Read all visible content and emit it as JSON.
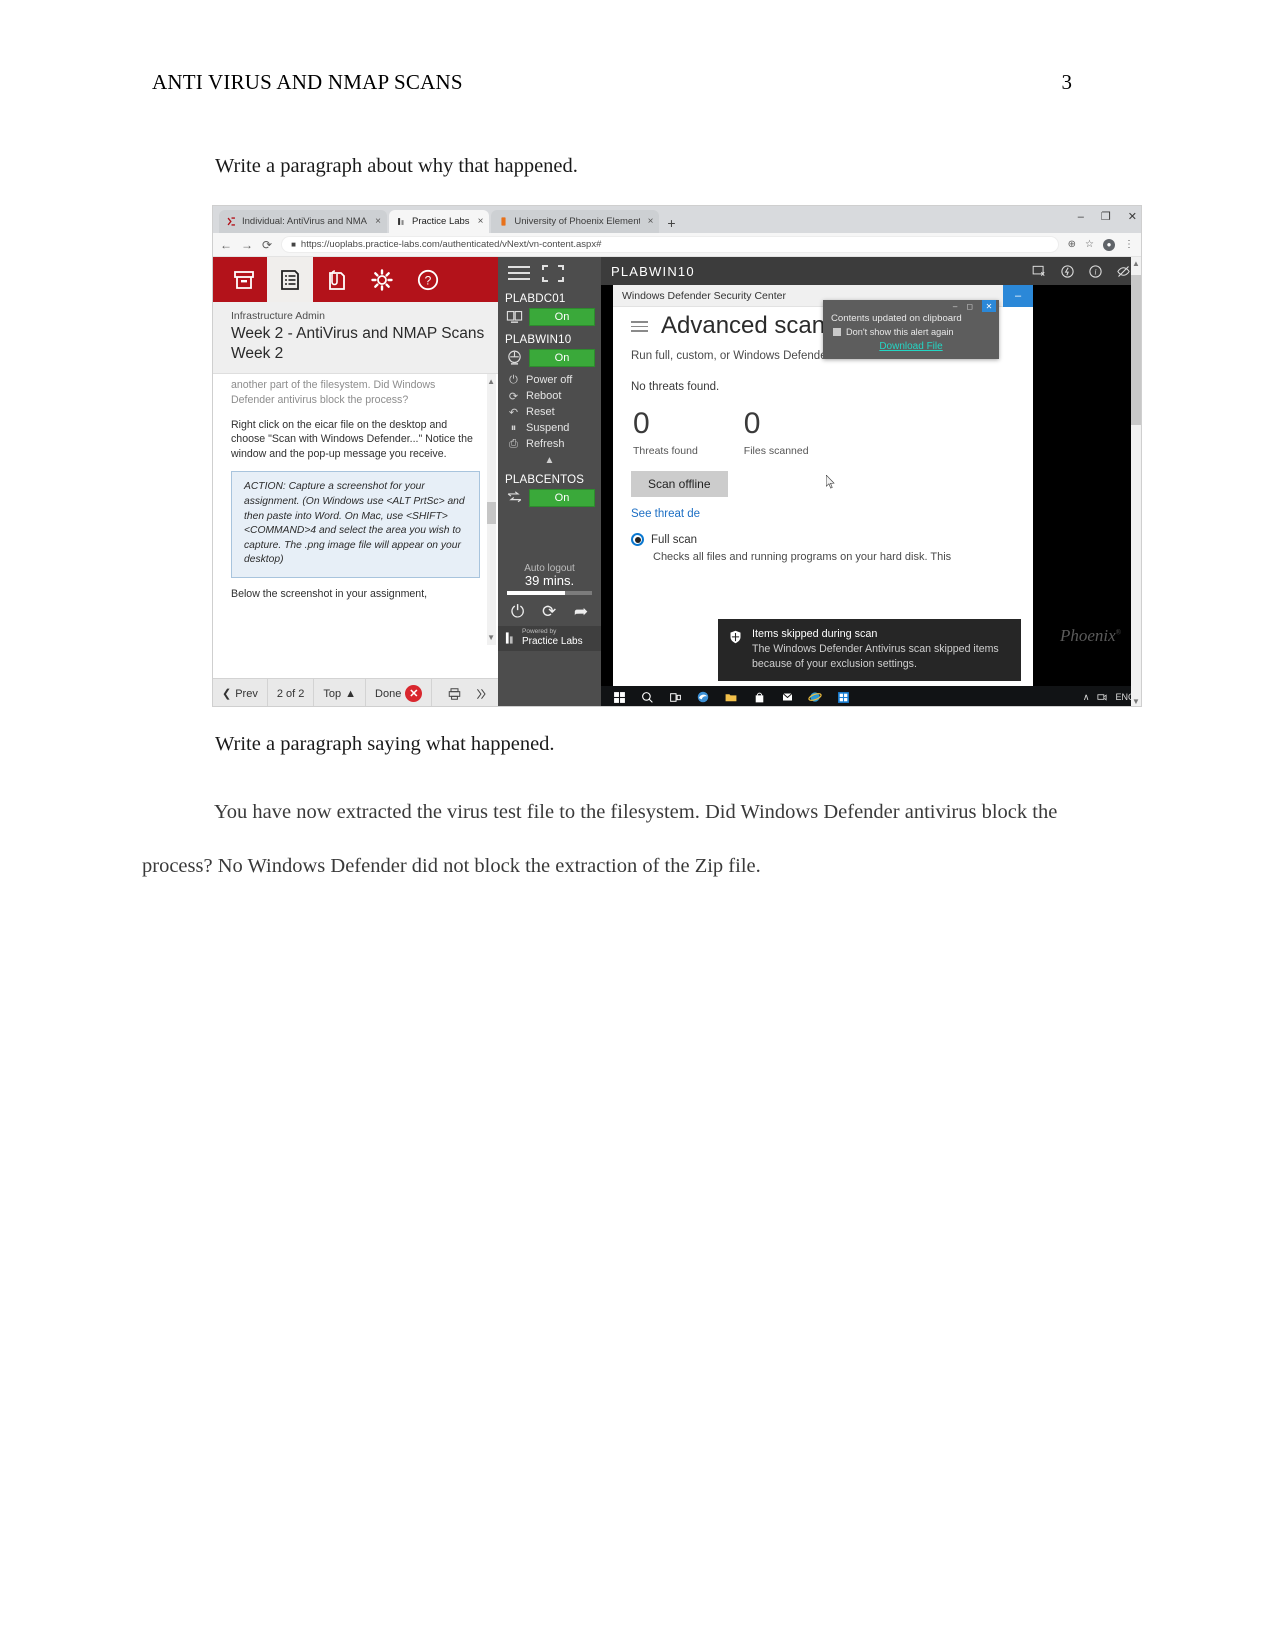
{
  "document": {
    "running_head": "ANTI VIRUS AND NMAP SCANS",
    "page_number": "3",
    "para_why": "Write a paragraph about why that happened.",
    "para_what": "Write a paragraph saying what happened.",
    "para_body": "You have now extracted the virus test file to the filesystem. Did Windows Defender antivirus block the process? No Windows Defender did not block the extraction of the Zip file."
  },
  "browser": {
    "tabs": [
      {
        "title": "Individual: AntiVirus and NMAP",
        "close": "×",
        "active": false
      },
      {
        "title": "Practice Labs",
        "close": "×",
        "active": true
      },
      {
        "title": "University of Phoenix Elementor",
        "close": "×",
        "active": false
      }
    ],
    "new_tab": "+",
    "window_controls": {
      "minimize": "–",
      "maximize": "❐",
      "close": "✕"
    },
    "nav": {
      "back": "←",
      "forward": "→",
      "reload": "⟳"
    },
    "url": "https://uoplabs.practice-labs.com/authenticated/vNext/vn-content.aspx#",
    "lock": "🔒",
    "zoom_icon": "⊕",
    "star_icon": "☆",
    "profile_initial": "●",
    "menu_icon": "⋮"
  },
  "lab": {
    "toolbar_icons": [
      "archive-icon",
      "content-icon",
      "attachment-icon",
      "settings-icon",
      "help-icon"
    ],
    "role": "Infrastructure Admin",
    "title": "Week 2 - AntiVirus and NMAP Scans",
    "week": "Week 2",
    "instructions": {
      "clipped": "another part of the filesystem. Did Windows Defender antivirus block the process?",
      "p2": "Right click on the eicar file on the desktop and choose \"Scan with Windows Defender...\" Notice the window and the pop-up message you receive.",
      "action": "ACTION: Capture a screenshot for your assignment. (On Windows use <ALT PrtSc> and then paste into Word. On Mac, use <SHIFT> <COMMAND>4 and select the area you wish to capture. The .png image file will appear on your desktop)",
      "p4": "Below the screenshot in your assignment,"
    },
    "nav": {
      "prev": "Prev",
      "page_counter": "2 of 2",
      "top": "Top",
      "done": "Done",
      "close": "✕",
      "print_icon": "print-icon",
      "notes_icon": "notes-icon"
    }
  },
  "vm_rail": {
    "menu_icon": "hamburger-icon",
    "expand_icon": "fullscreen-icon",
    "machines": [
      {
        "name": "PLABDC01",
        "state": "On",
        "icon": "server-icon",
        "expanded": false
      },
      {
        "name": "PLABWIN10",
        "state": "On",
        "icon": "desktop-icon",
        "expanded": true
      },
      {
        "name": "PLABCENTOS",
        "state": "On",
        "icon": "network-icon",
        "expanded": false
      }
    ],
    "power_menu": [
      {
        "label": "Power off",
        "icon": "power-icon"
      },
      {
        "label": "Reboot",
        "icon": "reboot-icon"
      },
      {
        "label": "Reset",
        "icon": "reset-icon"
      },
      {
        "label": "Suspend",
        "icon": "suspend-icon"
      },
      {
        "label": "Refresh",
        "icon": "refresh-icon"
      }
    ],
    "collapse_caret": "▲",
    "auto_logout_label": "Auto logout",
    "auto_logout_value": "39 mins.",
    "footer_small": "Powered by",
    "footer_brand": "Practice Labs",
    "bottom_icons": [
      "power-icon",
      "restart-icon",
      "send-keys-icon"
    ]
  },
  "vm_screen": {
    "title": "PLABWIN10",
    "toolbar_icons": [
      "screenshot-icon",
      "power-cycle-icon",
      "info-icon",
      "hide-icon"
    ],
    "defender": {
      "window_title": "Windows Defender Security Center",
      "pin_icon": "⊙",
      "menu_icon": "hamburger-icon",
      "heading": "Advanced scans",
      "subtitle": "Run full, custom, or Windows Defender Offline scan.",
      "no_threats": "No threats found.",
      "stats": [
        {
          "value": "0",
          "label": "Threats found"
        },
        {
          "value": "0",
          "label": "Files scanned"
        }
      ],
      "scan_offline_button": "Scan offline",
      "threat_link": "See threat de",
      "radio_label": "Full scan",
      "radio_desc": "Checks all files and running programs on your hard disk. This"
    },
    "clipboard_alert": {
      "message": "Contents updated on clipboard",
      "checkbox_label": "Don't show this alert again",
      "link": "Download File",
      "minimize": "–",
      "maximize": "⬜",
      "close": "✕"
    },
    "toast": {
      "icon": "shield-icon",
      "heading": "Items skipped during scan",
      "body": "The Windows Defender Antivirus scan skipped items because of your exclusion settings."
    },
    "watermark": "Phoenix",
    "watermark_sup": "®",
    "taskbar": {
      "icons": [
        "start-icon",
        "search-icon",
        "taskview-icon",
        "edge-icon",
        "explorer-icon",
        "store-icon",
        "mail-icon",
        "ie-icon",
        "defender-icon"
      ],
      "tray_caret": "∧",
      "tray_network": "network-icon",
      "language": "ENG"
    }
  },
  "colors": {
    "lab_red": "#b3121a",
    "vm_green": "#3aa93a",
    "accent_blue": "#2b88d8",
    "link_teal": "#24d6c4",
    "rail_gray": "#4d4d4d"
  }
}
